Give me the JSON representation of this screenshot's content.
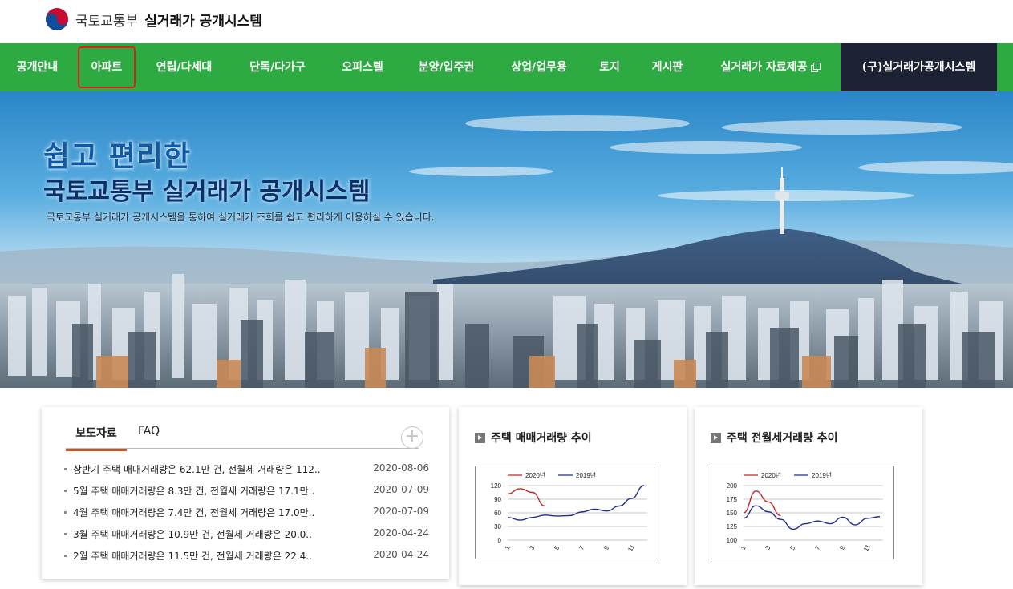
{
  "header": {
    "ministry": "국토교통부",
    "system": "실거래가 공개시스템"
  },
  "nav": {
    "items": [
      {
        "label": "공개안내"
      },
      {
        "label": "아파트"
      },
      {
        "label": "연립/다세대"
      },
      {
        "label": "단독/다가구"
      },
      {
        "label": "오피스텔"
      },
      {
        "label": "분양/입주권"
      },
      {
        "label": "상업/업무용"
      },
      {
        "label": "토지"
      },
      {
        "label": "게시판"
      },
      {
        "label": "실거래가 자료제공"
      }
    ],
    "old_system": "(구)실거래가공개시스템",
    "highlighted": "아파트"
  },
  "hero": {
    "title1": "쉽고 편리한",
    "title2": "국토교통부 실거래가 공개시스템",
    "desc": "국토교통부 실거래가 공개시스템을 통하여 실거래가 조회를 쉽고 편리하게 이용하실 수 있습니다."
  },
  "news": {
    "tabs": [
      "보도자료",
      "FAQ"
    ],
    "more": "+",
    "items": [
      {
        "title": "상반기 주택 매매거래량은 62.1만 건, 전월세 거래량은 112..",
        "date": "2020-08-06"
      },
      {
        "title": "5월 주택 매매거래량은 8.3만 건, 전월세 거래량은 17.1만..",
        "date": "2020-07-09"
      },
      {
        "title": "4월 주택 매매거래량은 7.4만 건, 전월세 거래량은 17.0만..",
        "date": "2020-07-09"
      },
      {
        "title": "3월 주택 매매거래량은 10.9만 건, 전월세 거래량은 20.0..",
        "date": "2020-04-24"
      },
      {
        "title": "2월 주택 매매거래량은 11.5만 건, 전월세 거래량은 22.4..",
        "date": "2020-04-24"
      }
    ]
  },
  "colors": {
    "nav_green": "#2eaa42",
    "old_system_bg": "#1c2233",
    "series_2020": "#c0262a",
    "series_2019": "#1f2e8c"
  },
  "chart_data": [
    {
      "type": "line",
      "title": "주택 매매거래량 추이",
      "x": [
        1,
        2,
        3,
        4,
        5,
        6,
        7,
        8,
        9,
        10,
        11,
        12
      ],
      "x_tick_labels": [
        "1",
        "3",
        "5",
        "7",
        "9",
        "11"
      ],
      "ylim": [
        0,
        120
      ],
      "y_ticks": [
        "120",
        "90",
        "60",
        "30",
        "0"
      ],
      "legend_position": "top-left",
      "grid": true,
      "series": [
        {
          "name": "2020년",
          "color": "#c0262a",
          "values": [
            102,
            113,
            105,
            75
          ]
        },
        {
          "name": "2019년",
          "color": "#1f2e8c",
          "values": [
            50,
            44,
            50,
            55,
            53,
            54,
            62,
            68,
            64,
            75,
            92,
            120
          ]
        }
      ]
    },
    {
      "type": "line",
      "title": "주택 전월세거래량 추이",
      "x": [
        1,
        2,
        3,
        4,
        5,
        6,
        7,
        8,
        9,
        10,
        11,
        12
      ],
      "x_tick_labels": [
        "1",
        "3",
        "5",
        "7",
        "9",
        "11"
      ],
      "ylim": [
        100,
        200
      ],
      "y_ticks": [
        "200",
        "175",
        "150",
        "125",
        "100"
      ],
      "legend_position": "top-left",
      "grid": true,
      "series": [
        {
          "name": "2020년",
          "color": "#c0262a",
          "values": [
            150,
            190,
            170,
            145
          ]
        },
        {
          "name": "2019년",
          "color": "#1f2e8c",
          "values": [
            140,
            163,
            152,
            138,
            120,
            130,
            135,
            130,
            142,
            128,
            140,
            143
          ]
        }
      ]
    }
  ]
}
